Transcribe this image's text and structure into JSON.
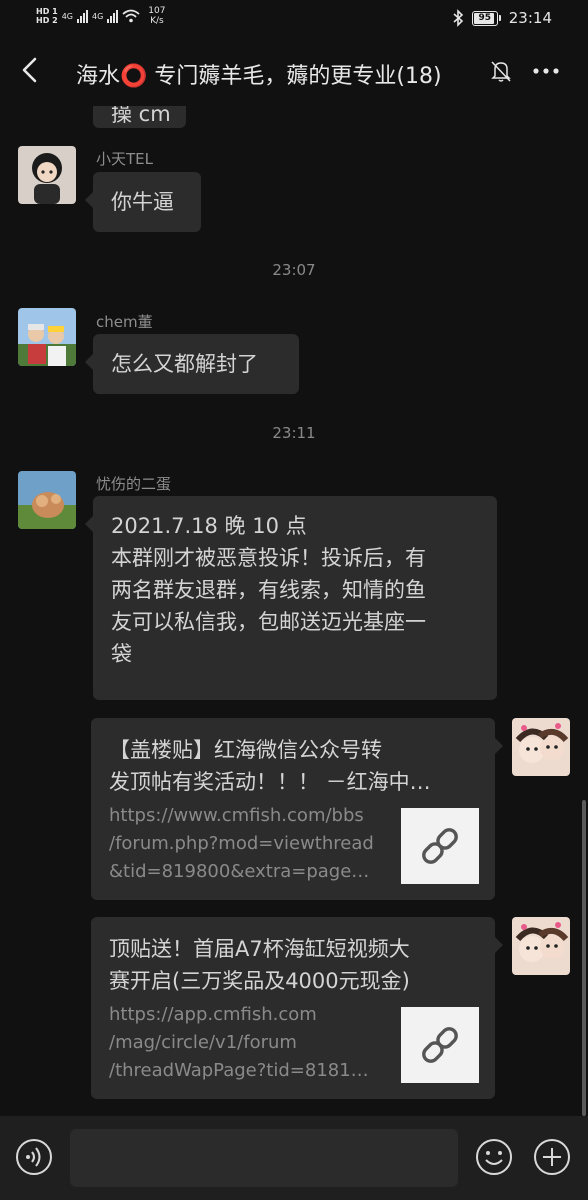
{
  "status": {
    "hd1": "HD 1",
    "hd2": "HD 2",
    "net1": "4G",
    "net2": "4G",
    "speed_value": "107",
    "speed_unit": "K/s",
    "battery": "95",
    "time": "23:14"
  },
  "header": {
    "title": "海水⭕ 专门薅羊毛，薅的更专业(18)",
    "icons": [
      "back-arrow-icon",
      "mute-bell-icon",
      "more-icon"
    ]
  },
  "messages": {
    "prev_partial": "操 cm",
    "m1": {
      "sender": "小天TEL",
      "text": "你牛逼"
    },
    "t1": "23:07",
    "m2": {
      "sender": "chem董",
      "text": "怎么又都解封了"
    },
    "t2": "23:11",
    "m3": {
      "sender": "忧伤的二蛋",
      "line1": "2021.7.18 晚 10 点",
      "line2": "本群刚才被恶意投诉！投诉后，有",
      "line3": "两名群友退群，有线索，知情的鱼",
      "line4": "友可以私信我，包邮送迈光基座一",
      "line5": "袋"
    },
    "link1": {
      "title_line1": "【盖楼贴】红海微信公众号转",
      "title_line2": "发顶帖有奖活动！！！ －红海中…",
      "url_line1": "https://www.cmfish.com/bbs",
      "url_line2": "/forum.php?mod=viewthread",
      "url_line3": "&tid=819800&extra=page…"
    },
    "link2": {
      "title_line1": "顶贴送！首届A7杯海缸短视频大",
      "title_line2": "赛开启(三万奖品及4000元现金)",
      "url_line1": "https://app.cmfish.com",
      "url_line2": "/mag/circle/v1/forum",
      "url_line3": "/threadWapPage?tid=8181…"
    }
  },
  "input": {
    "icons": [
      "voice-icon",
      "emoji-icon",
      "plus-icon"
    ]
  }
}
